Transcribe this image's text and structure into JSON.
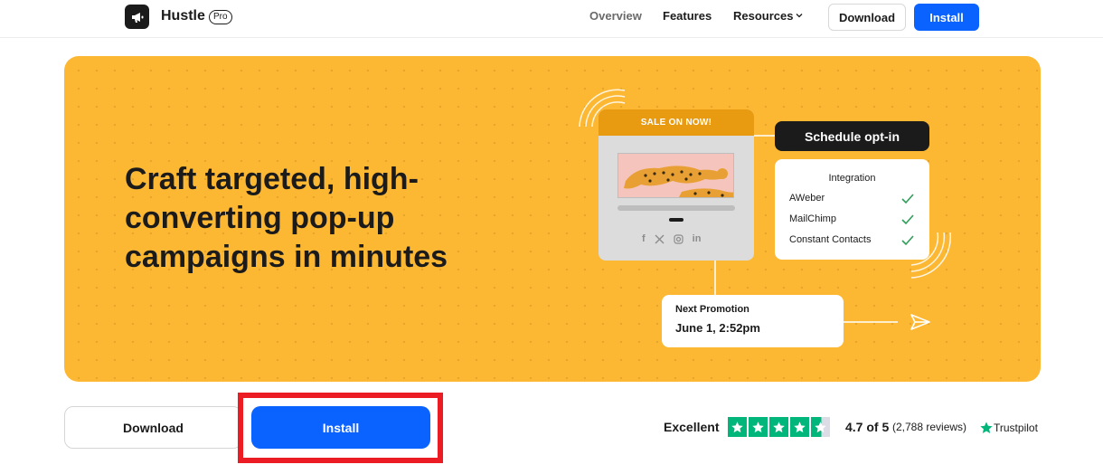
{
  "nav": {
    "brand": "Hustle",
    "badge": "Pro",
    "links": [
      "Overview",
      "Features",
      "Resources"
    ],
    "download_label": "Download",
    "install_label": "Install"
  },
  "hero": {
    "title": "Craft targeted, high-converting pop-up campaigns in minutes",
    "popup_header": "SALE ON NOW!",
    "schedule_label": "Schedule opt-in",
    "integration": {
      "title": "Integration",
      "items": [
        "AWeber",
        "MailChimp",
        "Constant Contacts"
      ]
    },
    "promo": {
      "label": "Next Promotion",
      "date": "June 1, 2:52pm"
    },
    "social_icons": [
      "facebook-icon",
      "x-icon",
      "instagram-icon",
      "linkedin-icon"
    ]
  },
  "actions": {
    "download_label": "Download",
    "install_label": "Install"
  },
  "rating": {
    "word": "Excellent",
    "stars": 4.7,
    "score": "4.7 of 5",
    "reviews": "(2,788 reviews)",
    "provider": "Trustpilot"
  },
  "colors": {
    "accent_blue": "#0a62ff",
    "hero_yellow": "#fdb833",
    "popup_orange": "#e89a10",
    "trustpilot_green": "#00b67a",
    "highlight_red": "#ec1c24"
  }
}
